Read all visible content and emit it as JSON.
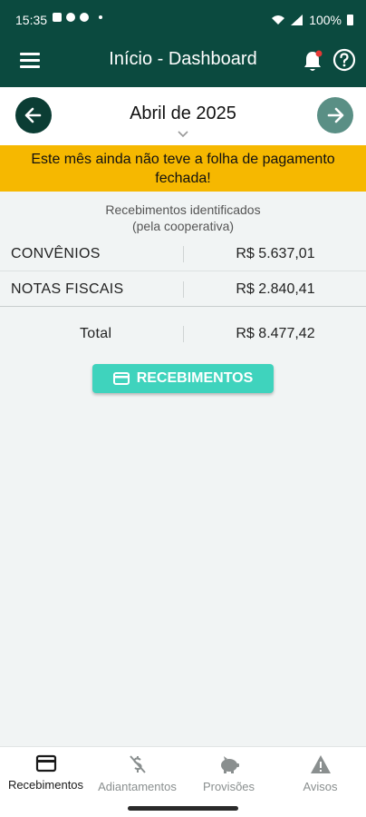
{
  "status_bar": {
    "time": "15:35",
    "battery": "100%"
  },
  "app_bar": {
    "title": "Início - Dashboard",
    "menu_icon": "menu-icon",
    "bell_icon": "bell-icon",
    "help_icon": "help-icon"
  },
  "month_selector": {
    "label": "Abril de 2025",
    "prev_icon": "arrow-left-icon",
    "next_icon": "arrow-right-icon"
  },
  "warning": {
    "text": "Este mês ainda não teve a folha de pagamento fechada!"
  },
  "summary": {
    "caption_line1": "Recebimentos identificados",
    "caption_line2": "(pela cooperativa)",
    "rows": [
      {
        "label": "CONVÊNIOS",
        "value": "R$ 5.637,01"
      },
      {
        "label": "NOTAS FISCAIS",
        "value": "R$ 2.840,41"
      }
    ],
    "total_label": "Total",
    "total_value": "R$ 8.477,42"
  },
  "recebimentos_button": {
    "label": "RECEBIMENTOS",
    "icon": "credit-card-icon"
  },
  "bottom_nav": [
    {
      "label": "Recebimentos",
      "icon": "credit-card-icon",
      "active": true
    },
    {
      "label": "Adiantamentos",
      "icon": "money-off-icon",
      "active": false
    },
    {
      "label": "Provisões",
      "icon": "piggy-bank-icon",
      "active": false
    },
    {
      "label": "Avisos",
      "icon": "warning-icon",
      "active": false
    }
  ],
  "colors": {
    "primary": "#0b4a3f",
    "accent": "#3fd3bd",
    "warning": "#f6b800"
  }
}
